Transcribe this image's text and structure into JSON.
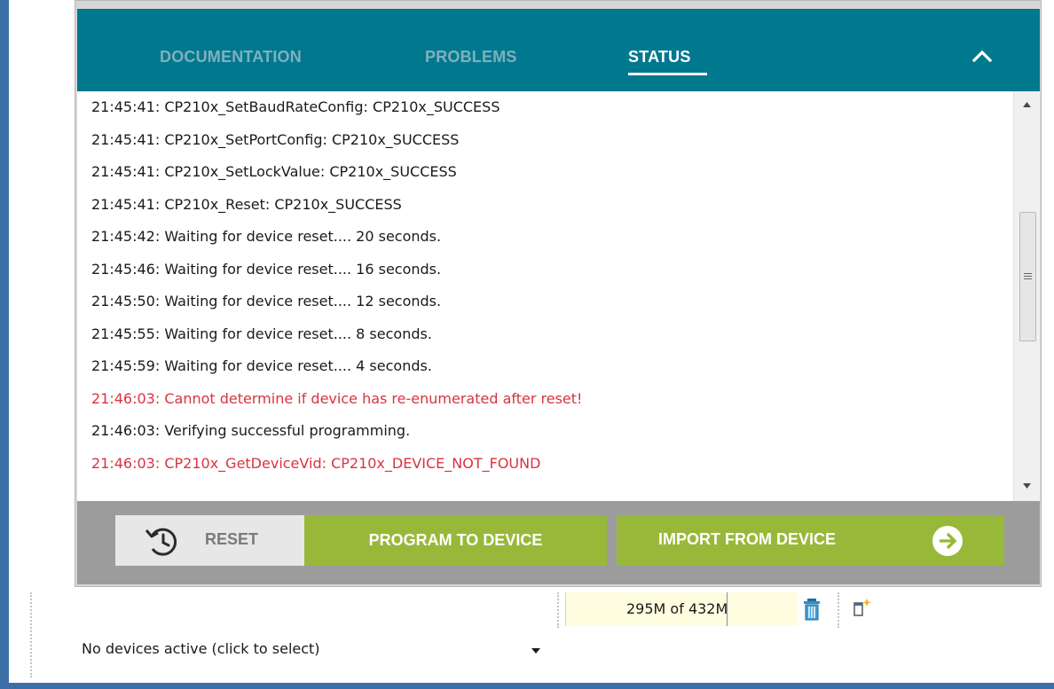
{
  "tabs": [
    {
      "label": "DOCUMENTATION"
    },
    {
      "label": "PROBLEMS"
    },
    {
      "label": "STATUS",
      "active": true
    }
  ],
  "collapse_icon": "chevron-up-icon",
  "log_lines": [
    {
      "text": "21:45:41: CP210x_SetBaudRateConfig: CP210x_SUCCESS",
      "level": "info"
    },
    {
      "text": "21:45:41: CP210x_SetPortConfig: CP210x_SUCCESS",
      "level": "info"
    },
    {
      "text": "21:45:41: CP210x_SetLockValue: CP210x_SUCCESS",
      "level": "info"
    },
    {
      "text": "21:45:41: CP210x_Reset: CP210x_SUCCESS",
      "level": "info"
    },
    {
      "text": "21:45:42: Waiting for device reset.... 20 seconds.",
      "level": "info"
    },
    {
      "text": "21:45:46: Waiting for device reset.... 16 seconds.",
      "level": "info"
    },
    {
      "text": "21:45:50: Waiting for device reset.... 12 seconds.",
      "level": "info"
    },
    {
      "text": "21:45:55: Waiting for device reset.... 8 seconds.",
      "level": "info"
    },
    {
      "text": "21:45:59: Waiting for device reset.... 4 seconds.",
      "level": "info"
    },
    {
      "text": "21:46:03: Cannot determine if device has re-enumerated after reset!",
      "level": "error"
    },
    {
      "text": "21:46:03: Verifying successful programming.",
      "level": "info"
    },
    {
      "text": "21:46:03: CP210x_GetDeviceVid: CP210x_DEVICE_NOT_FOUND",
      "level": "error"
    }
  ],
  "actions": {
    "reset_label": "RESET",
    "program_label": "PROGRAM TO DEVICE",
    "import_label": "IMPORT FROM DEVICE"
  },
  "status_bar": {
    "memory": "295M of 432M",
    "device_status": "No devices active (click to select)"
  },
  "colors": {
    "tab_bar": "#00788e",
    "accent_green": "#98b83a",
    "error_text": "#d8343f"
  }
}
